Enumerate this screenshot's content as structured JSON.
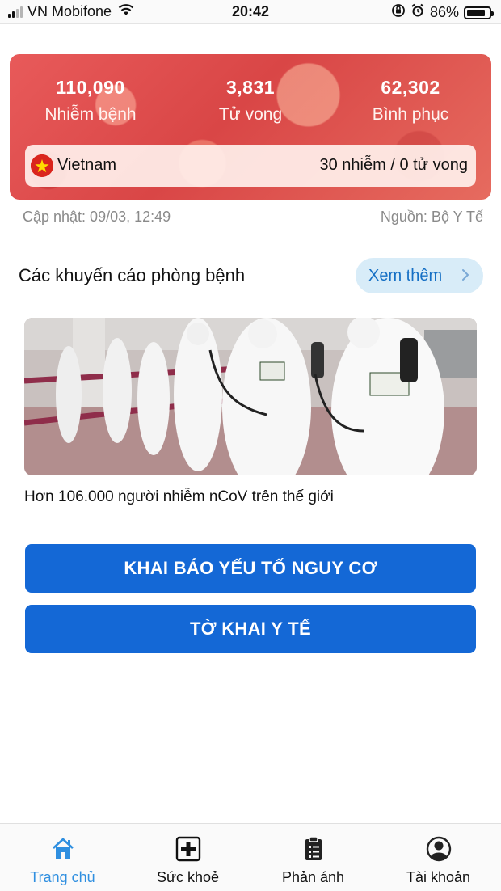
{
  "status_bar": {
    "carrier": "VN Mobifone",
    "time": "20:42",
    "battery": "86%",
    "battery_level": 0.86
  },
  "stats": {
    "cases": {
      "value": "110,090",
      "label": "Nhiễm bệnh"
    },
    "deaths": {
      "value": "3,831",
      "label": "Tử vong"
    },
    "recovered": {
      "value": "62,302",
      "label": "Bình phục"
    },
    "country": {
      "name": "Vietnam",
      "summary": "30 nhiễm / 0 tử vong",
      "flag_icon": "vietnam-flag-icon"
    }
  },
  "meta": {
    "updated": "Cập nhật: 09/03, 12:49",
    "source": "Nguồn: Bộ Y Tế"
  },
  "advice": {
    "title": "Các khuyến cáo phòng bệnh",
    "see_more": "Xem thêm",
    "news_caption": "Hơn 106.000 người nhiễm nCoV trên thế giới"
  },
  "buttons": {
    "risk_declaration": "KHAI BÁO YẾU TỐ NGUY CƠ",
    "medical_declaration": "TỜ KHAI Y TẾ"
  },
  "tabs": [
    {
      "label": "Trang chủ",
      "icon": "home-icon",
      "active": true
    },
    {
      "label": "Sức khoẻ",
      "icon": "medical-cross-icon",
      "active": false
    },
    {
      "label": "Phản ánh",
      "icon": "clipboard-icon",
      "active": false
    },
    {
      "label": "Tài khoản",
      "icon": "user-icon",
      "active": false
    }
  ],
  "colors": {
    "primary_button": "#1468d6",
    "active_tab": "#2f8fe0",
    "stats_card": "#d94646",
    "see_more_bg": "#d8ecf8"
  }
}
